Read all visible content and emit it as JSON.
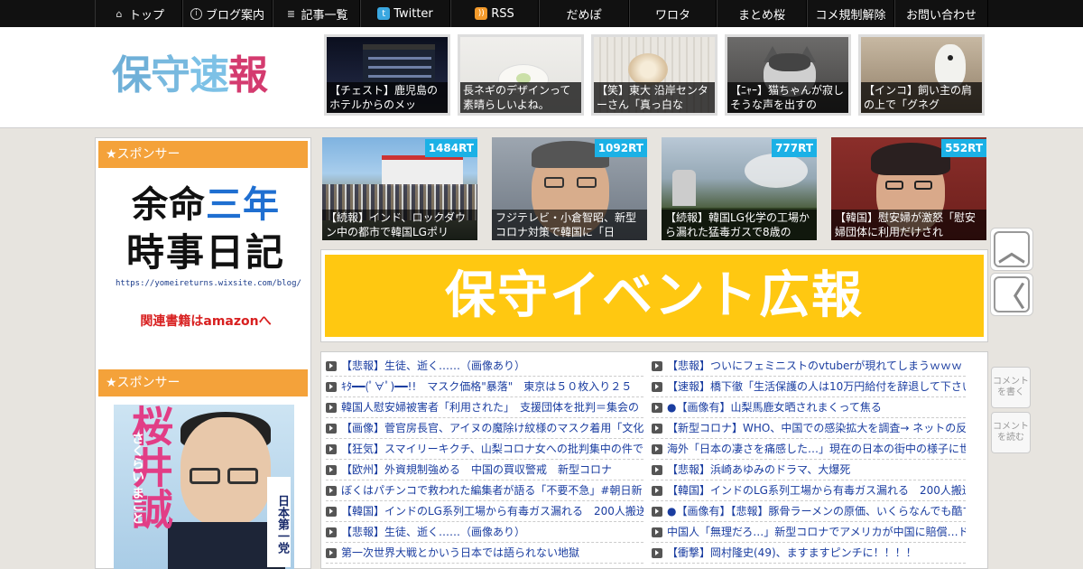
{
  "nav": {
    "items": [
      {
        "label": "トップ",
        "icon": "home-icon"
      },
      {
        "label": "ブログ案内",
        "icon": "info-icon"
      },
      {
        "label": "記事一覧",
        "icon": "list-icon"
      },
      {
        "label": "Twitter",
        "icon": "twitter-icon"
      },
      {
        "label": "RSS",
        "icon": "rss-icon"
      },
      {
        "label": "だめぽ",
        "icon": ""
      },
      {
        "label": "ワロタ",
        "icon": ""
      },
      {
        "label": "まとめ桜",
        "icon": ""
      },
      {
        "label": "コメ規制解除",
        "icon": ""
      },
      {
        "label": "お問い合わせ",
        "icon": ""
      }
    ]
  },
  "header": {
    "logo": [
      "保",
      "守",
      "速",
      "報"
    ],
    "thumbs": [
      {
        "caption": "【チェスト】鹿児島のホテルからのメッ"
      },
      {
        "caption": "長ネギのデザインって素晴らしいよね。"
      },
      {
        "caption": "【笑】東大 沿岸センターさん「真っ白な"
      },
      {
        "caption": "【ﾆｬｰ】猫ちゃんが寂しそうな声を出すの"
      },
      {
        "caption": "【インコ】飼い主の肩の上で「グネグ"
      }
    ]
  },
  "sidebar": {
    "sponsor_label_1": "★スポンサー",
    "sponsor_label_2": "★スポンサー",
    "ad1": {
      "line1a": "余命",
      "line1b": "三年",
      "line2": "時事日記",
      "url": "https://yomeireturns.wixsite.com/blog/",
      "amazon": "関連書籍はamazonへ"
    },
    "ad2": {
      "name": "桜井誠",
      "kana": "さくらい まこと",
      "party": "日本第一党"
    }
  },
  "rt_cards": [
    {
      "rt": "1484RT",
      "caption": "【続報】インド、ロックダウン中の都市で韓国LGポリ"
    },
    {
      "rt": "1092RT",
      "caption": "フジテレビ・小倉智昭、新型コロナ対策で韓国に「日"
    },
    {
      "rt": "777RT",
      "caption": "【続報】韓国LG化学の工場から漏れた猛毒ガスで8歳の"
    },
    {
      "rt": "552RT",
      "caption": "【韓国】慰安婦が激怒「慰安婦団体に利用だけされ"
    }
  ],
  "banner": {
    "text": "保守イベント広報"
  },
  "side": {
    "up": "︿",
    "back": "〈",
    "comment_write": "コメントを書く",
    "comment_read": "コメントを読む"
  },
  "lists": {
    "left": [
      "【悲報】生徒、逝く……（画像あり）",
      "ｷﾀ━━(ﾟ∀ﾟ)━━!!　マスク価格\"暴落\"　東京は５０枚入り２５",
      "韓国人慰安婦被害者「利用された」　支援団体を批判＝集会の",
      "【画像】菅官房長官、アイヌの魔除け紋様のマスク着用「文化",
      "【狂気】スマイリーキクチ、山梨コロナ女への批判集中の件で",
      "【欧州】外資規制強める　中国の買収警戒　新型コロナ",
      "ぼくはパチンコで救われた編集者が語る「不要不急」#朝日新",
      "【韓国】インドのLG系列工場から有毒ガス漏れる　200人搬送",
      "【悲報】生徒、逝く……（画像あり）",
      "第一次世界大戦とかいう日本では語られない地獄"
    ],
    "right": [
      "【悲報】ついにフェミニストのvtuberが現れてしまうｗｗｗ",
      "【速報】橋下徹「生活保護の人は10万円給付を辞退して下さい",
      "●【画像有】山梨馬鹿女晒されまくって焦る",
      "【新型コロナ】WHO、中国での感染拡大を調査→ ネットの反応",
      "海外「日本の凄さを痛感した…」現在の日本の街中の様子に世",
      "【悲報】浜崎あゆみのドラマ、大爆死",
      "【韓国】インドのLG系列工場から有毒ガス漏れる　200人搬送",
      "●【画像有】【悲報】豚骨ラーメンの原価、いくらなんでも酷す",
      "中国人「無理だろ…」新型コロナでアメリカが中国に賠償…ド",
      "【衝撃】岡村隆史(49)、ますますピンチに！！！！"
    ]
  }
}
